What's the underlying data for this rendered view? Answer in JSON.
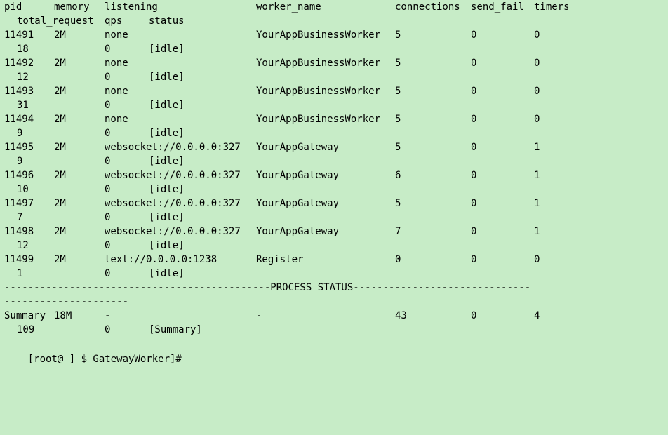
{
  "header": {
    "pid": "pid",
    "memory": "memory",
    "listening": "listening",
    "worker_name": "worker_name",
    "connections": "connections",
    "send_fail": "send_fail",
    "timers": "timers",
    "total_request": "total_request",
    "qps": "qps",
    "status": "status"
  },
  "rows": [
    {
      "pid": "11491",
      "memory": "2M",
      "listening": "none",
      "worker_name": "YourAppBusinessWorker",
      "connections": "5",
      "send_fail": "0",
      "timers": "0",
      "total_request": "18",
      "qps": "0",
      "status": "[idle]"
    },
    {
      "pid": "11492",
      "memory": "2M",
      "listening": "none",
      "worker_name": "YourAppBusinessWorker",
      "connections": "5",
      "send_fail": "0",
      "timers": "0",
      "total_request": "12",
      "qps": "0",
      "status": "[idle]"
    },
    {
      "pid": "11493",
      "memory": "2M",
      "listening": "none",
      "worker_name": "YourAppBusinessWorker",
      "connections": "5",
      "send_fail": "0",
      "timers": "0",
      "total_request": "31",
      "qps": "0",
      "status": "[idle]"
    },
    {
      "pid": "11494",
      "memory": "2M",
      "listening": "none",
      "worker_name": "YourAppBusinessWorker",
      "connections": "5",
      "send_fail": "0",
      "timers": "0",
      "total_request": "9",
      "qps": "0",
      "status": "[idle]"
    },
    {
      "pid": "11495",
      "memory": "2M",
      "listening": "websocket://0.0.0.0:327",
      "worker_name": "YourAppGateway",
      "connections": "5",
      "send_fail": "0",
      "timers": "1",
      "total_request": "9",
      "qps": "0",
      "status": "[idle]"
    },
    {
      "pid": "11496",
      "memory": "2M",
      "listening": "websocket://0.0.0.0:327",
      "worker_name": "YourAppGateway",
      "connections": "6",
      "send_fail": "0",
      "timers": "1",
      "total_request": "10",
      "qps": "0",
      "status": "[idle]"
    },
    {
      "pid": "11497",
      "memory": "2M",
      "listening": "websocket://0.0.0.0:327",
      "worker_name": "YourAppGateway",
      "connections": "5",
      "send_fail": "0",
      "timers": "1",
      "total_request": "7",
      "qps": "0",
      "status": "[idle]"
    },
    {
      "pid": "11498",
      "memory": "2M",
      "listening": "websocket://0.0.0.0:327",
      "worker_name": "YourAppGateway",
      "connections": "7",
      "send_fail": "0",
      "timers": "1",
      "total_request": "12",
      "qps": "0",
      "status": "[idle]"
    },
    {
      "pid": "11499",
      "memory": "2M",
      "listening": "text://0.0.0.0:1238",
      "worker_name": "Register",
      "connections": "0",
      "send_fail": "0",
      "timers": "0",
      "total_request": "1",
      "qps": "0",
      "status": "[idle]"
    }
  ],
  "separator": {
    "line1": "---------------------------------------------PROCESS STATUS------------------------------",
    "line2": "---------------------"
  },
  "summary": {
    "pid": "Summary",
    "memory": "18M",
    "listening": "-",
    "worker_name": "-",
    "connections": "43",
    "send_fail": "0",
    "timers": "4",
    "total_request": "109",
    "qps": "0",
    "status": "[Summary]"
  },
  "prompt": {
    "text": "[root@ ] $ GatewayWorker]# "
  }
}
